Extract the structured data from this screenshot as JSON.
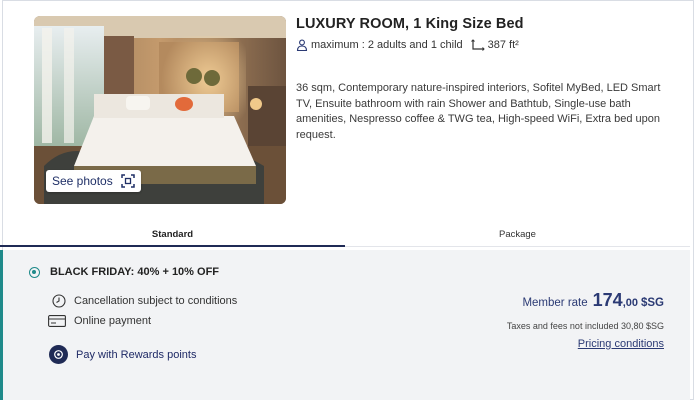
{
  "room": {
    "title": "LUXURY ROOM, 1 King Size Bed",
    "capacity": "maximum : 2 adults and 1 child",
    "area": "387 ft²",
    "description": "36 sqm, Contemporary nature-inspired interiors, Sofitel MyBed, LED Smart TV, Ensuite bathroom with rain Shower and Bathtub, Single-use bath amenities, Nespresso coffee & TWG tea, High-speed WiFi, Extra bed upon request.",
    "see_photos_label": "See photos",
    "icons": {
      "capacity": "person-icon",
      "area": "area-icon",
      "gallery": "expand-icon"
    }
  },
  "tabs": [
    {
      "label": "Standard",
      "active": true
    },
    {
      "label": "Package",
      "active": false
    }
  ],
  "offer": {
    "name": "BLACK FRIDAY: 40% + 10% OFF",
    "selected": true,
    "features": [
      {
        "label": "Cancellation subject to conditions",
        "icon": "clock-icon"
      },
      {
        "label": "Online payment",
        "icon": "credit-card-icon"
      }
    ],
    "rewards_label": "Pay with Rewards points",
    "member_rate_label": "Member rate",
    "price_integer": "174",
    "price_decimal": ",00",
    "currency": "$SG",
    "taxes_note": "Taxes and fees not included 30,80 $SG",
    "pricing_conditions_label": "Pricing conditions"
  },
  "colors": {
    "brand_navy": "#1f2a55",
    "accent_teal": "#1f8a8a",
    "panel_bg": "#f2f3f5"
  }
}
